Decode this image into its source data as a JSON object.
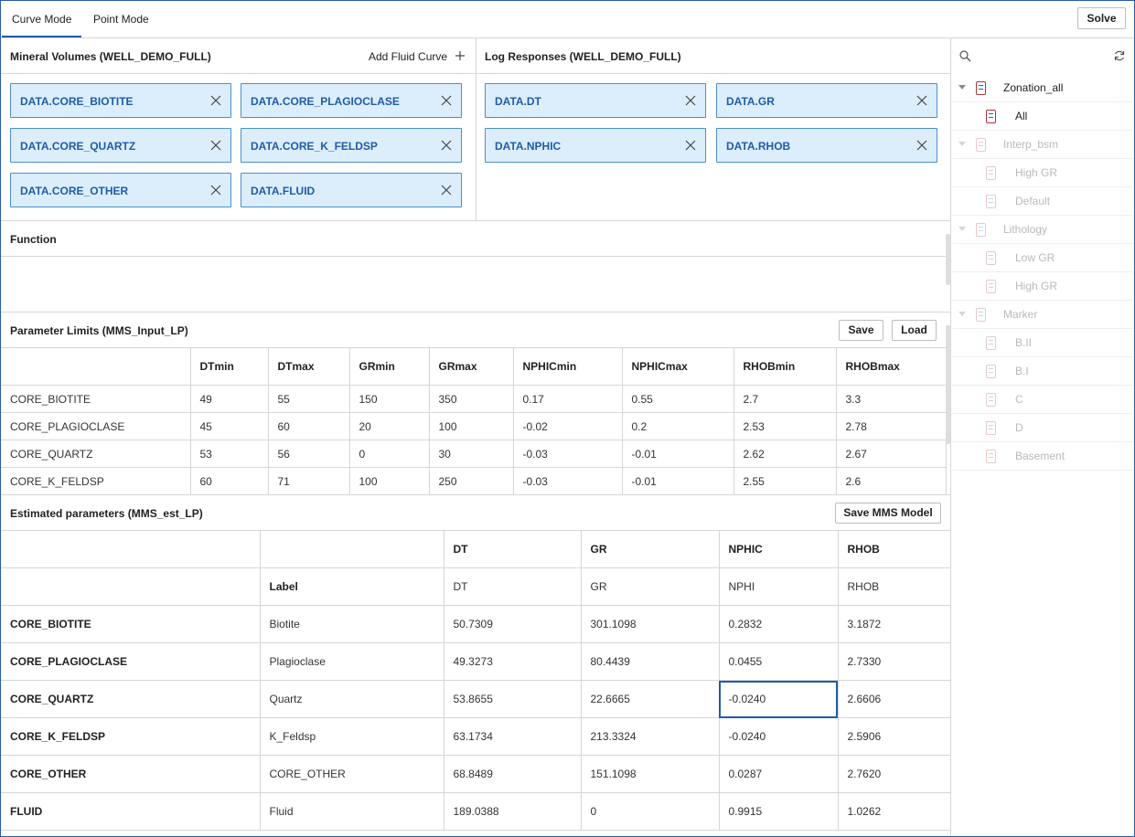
{
  "tabs": [
    "Curve Mode",
    "Point Mode"
  ],
  "solve_label": "Solve",
  "mineral_panel": {
    "title": "Mineral Volumes (WELL_DEMO_FULL)",
    "add_label": "Add Fluid Curve",
    "chips": [
      "DATA.CORE_BIOTITE",
      "DATA.CORE_PLAGIOCLASE",
      "DATA.CORE_QUARTZ",
      "DATA.CORE_K_FELDSP",
      "DATA.CORE_OTHER",
      "DATA.FLUID"
    ]
  },
  "log_panel": {
    "title": "Log Responses (WELL_DEMO_FULL)",
    "chips": [
      "DATA.DT",
      "DATA.GR",
      "DATA.NPHIC",
      "DATA.RHOB"
    ]
  },
  "function_title": "Function",
  "limits": {
    "title": "Parameter Limits (MMS_Input_LP)",
    "save_label": "Save",
    "load_label": "Load",
    "columns": [
      "",
      "DTmin",
      "DTmax",
      "GRmin",
      "GRmax",
      "NPHICmin",
      "NPHICmax",
      "RHOBmin",
      "RHOBmax"
    ],
    "rows": [
      [
        "CORE_BIOTITE",
        "49",
        "55",
        "150",
        "350",
        "0.17",
        "0.55",
        "2.7",
        "3.3"
      ],
      [
        "CORE_PLAGIOCLASE",
        "45",
        "60",
        "20",
        "100",
        "-0.02",
        "0.2",
        "2.53",
        "2.78"
      ],
      [
        "CORE_QUARTZ",
        "53",
        "56",
        "0",
        "30",
        "-0.03",
        "-0.01",
        "2.62",
        "2.67"
      ],
      [
        "CORE_K_FELDSP",
        "60",
        "71",
        "100",
        "250",
        "-0.03",
        "-0.01",
        "2.55",
        "2.6"
      ]
    ]
  },
  "estimated": {
    "title": "Estimated parameters (MMS_est_LP)",
    "save_label": "Save MMS Model",
    "header1": [
      "",
      "",
      "DT",
      "GR",
      "NPHIC",
      "RHOB"
    ],
    "header2": [
      "",
      "Label",
      "DT",
      "GR",
      "NPHI",
      "RHOB"
    ],
    "rows": [
      [
        "CORE_BIOTITE",
        "Biotite",
        "50.7309",
        "301.1098",
        "0.2832",
        "3.1872"
      ],
      [
        "CORE_PLAGIOCLASE",
        "Plagioclase",
        "49.3273",
        "80.4439",
        "0.0455",
        "2.7330"
      ],
      [
        "CORE_QUARTZ",
        "Quartz",
        "53.8655",
        "22.6665",
        "-0.0240",
        "2.6606"
      ],
      [
        "CORE_K_FELDSP",
        "K_Feldsp",
        "63.1734",
        "213.3324",
        "-0.0240",
        "2.5906"
      ],
      [
        "CORE_OTHER",
        "CORE_OTHER",
        "68.8489",
        "151.1098",
        "0.0287",
        "2.7620"
      ],
      [
        "FLUID",
        "Fluid",
        "189.0388",
        "0",
        "0.9915",
        "1.0262"
      ]
    ]
  },
  "tree": [
    {
      "label": "Zonation_all",
      "level": 0,
      "dim": false,
      "caret": true
    },
    {
      "label": "All",
      "level": 1,
      "dim": false,
      "caret": false
    },
    {
      "label": "Interp_bsm",
      "level": 0,
      "dim": true,
      "caret": true
    },
    {
      "label": "High GR",
      "level": 1,
      "dim": true,
      "caret": false
    },
    {
      "label": "Default",
      "level": 1,
      "dim": true,
      "caret": false
    },
    {
      "label": "Lithology",
      "level": 0,
      "dim": true,
      "caret": true
    },
    {
      "label": "Low GR",
      "level": 1,
      "dim": true,
      "caret": false
    },
    {
      "label": "High GR",
      "level": 1,
      "dim": true,
      "caret": false
    },
    {
      "label": "Marker",
      "level": 0,
      "dim": true,
      "caret": true
    },
    {
      "label": "B.II",
      "level": 1,
      "dim": true,
      "caret": false
    },
    {
      "label": "B.I",
      "level": 1,
      "dim": true,
      "caret": false
    },
    {
      "label": "C",
      "level": 1,
      "dim": true,
      "caret": false
    },
    {
      "label": "D",
      "level": 1,
      "dim": true,
      "caret": false
    },
    {
      "label": "Basement",
      "level": 1,
      "dim": true,
      "caret": false
    }
  ],
  "colors": {
    "accent": "#1f5ca8",
    "chip_bg": "#dceefb",
    "chip_border": "#4a8fd1"
  }
}
